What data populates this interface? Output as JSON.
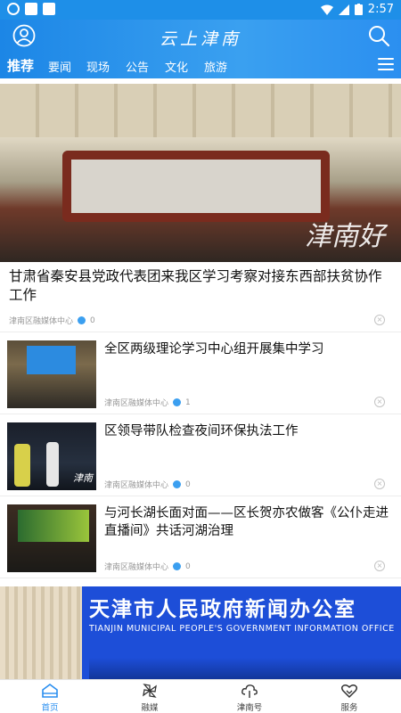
{
  "status_bar": {
    "time": "2:57"
  },
  "header": {
    "title": "云上津南"
  },
  "nav": {
    "tabs": [
      "推荐",
      "要闻",
      "现场",
      "公告",
      "文化",
      "旅游"
    ],
    "active": "推荐"
  },
  "feed": {
    "hero": {
      "watermark": "津南好",
      "title": "甘肃省秦安县党政代表团来我区学习考察对接东西部扶贫协作工作",
      "source": "津南区融媒体中心",
      "likes": "0"
    },
    "items": [
      {
        "title": "全区两级理论学习中心组开展集中学习",
        "source": "津南区融媒体中心",
        "likes": "1"
      },
      {
        "title": "区领导带队检查夜间环保执法工作",
        "source": "津南区融媒体中心",
        "likes": "0",
        "watermark": "津南"
      },
      {
        "title": "与河长湖长面对面——区长贺亦农做客《公仆走进直播间》共话河湖治理",
        "source": "津南区融媒体中心",
        "likes": "0"
      }
    ],
    "banner": {
      "cn": "天津市人民政府新闻办公室",
      "en": "TIANJIN MUNICIPAL PEOPLE'S GOVERNMENT INFORMATION OFFICE"
    }
  },
  "tabbar": {
    "items": [
      {
        "label": "首页",
        "icon": "home-icon",
        "active": true
      },
      {
        "label": "融媒",
        "icon": "pinwheel-icon",
        "active": false
      },
      {
        "label": "津南号",
        "icon": "cloud-icon",
        "active": false
      },
      {
        "label": "服务",
        "icon": "handshake-heart-icon",
        "active": false
      }
    ]
  },
  "colors": {
    "primary": "#2b8ff0",
    "text": "#111111",
    "meta": "#999999"
  }
}
